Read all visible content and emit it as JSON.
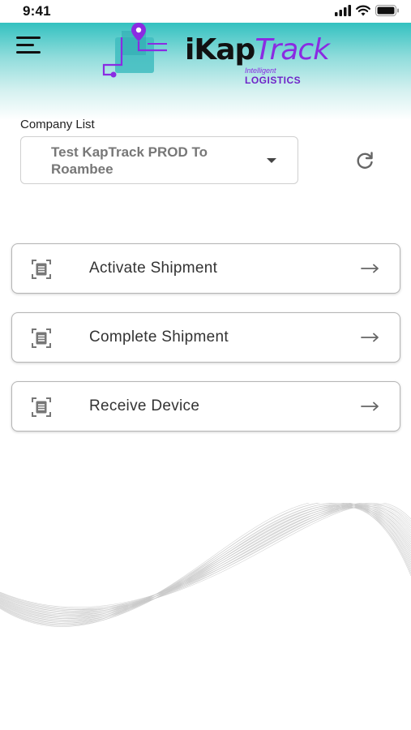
{
  "status": {
    "time": "9:41",
    "icons": [
      "signal-icon",
      "wifi-icon",
      "battery-icon"
    ]
  },
  "header": {
    "brand_prefix": "iKap",
    "brand_suffix": "Track",
    "tagline_1": "Intelligent",
    "tagline_2": "LOGISTICS",
    "menu_icon": "hamburger-menu-icon",
    "colors": {
      "teal": "#33c1c0",
      "purple": "#8a2be2"
    }
  },
  "company": {
    "label": "Company List",
    "selected": "Test KapTrack PROD To Roambee",
    "refresh_icon": "refresh-icon"
  },
  "actions": [
    {
      "label": "Activate Shipment",
      "icon": "scan-document-icon"
    },
    {
      "label": "Complete Shipment",
      "icon": "scan-document-icon"
    },
    {
      "label": "Receive Device",
      "icon": "scan-document-icon"
    }
  ]
}
